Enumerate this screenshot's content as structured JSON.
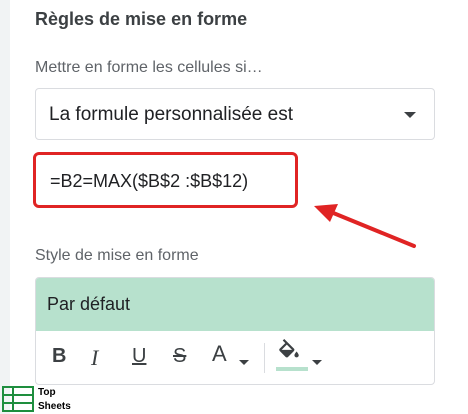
{
  "panel": {
    "section_title": "Règles de mise en forme",
    "apply_label": "Mettre en forme les cellules si…",
    "condition_value": "La formule personnalisée est",
    "formula_value": "=B2=MAX($B$2 :$B$12)",
    "style_label": "Style de mise en forme",
    "preview_text": "Par défaut"
  },
  "toolbar": {
    "bold": "B",
    "italic": "I",
    "underline": "U",
    "strike": "S",
    "text_color": "A"
  },
  "logo": {
    "line1": "Top",
    "line2": "Sheets"
  },
  "colors": {
    "preview_bg": "#b7e1cd",
    "highlight_red": "#e02424"
  },
  "icons": [
    "chevron-down-icon",
    "paint-bucket-icon",
    "arrow-icon",
    "sheets-logo-icon"
  ]
}
